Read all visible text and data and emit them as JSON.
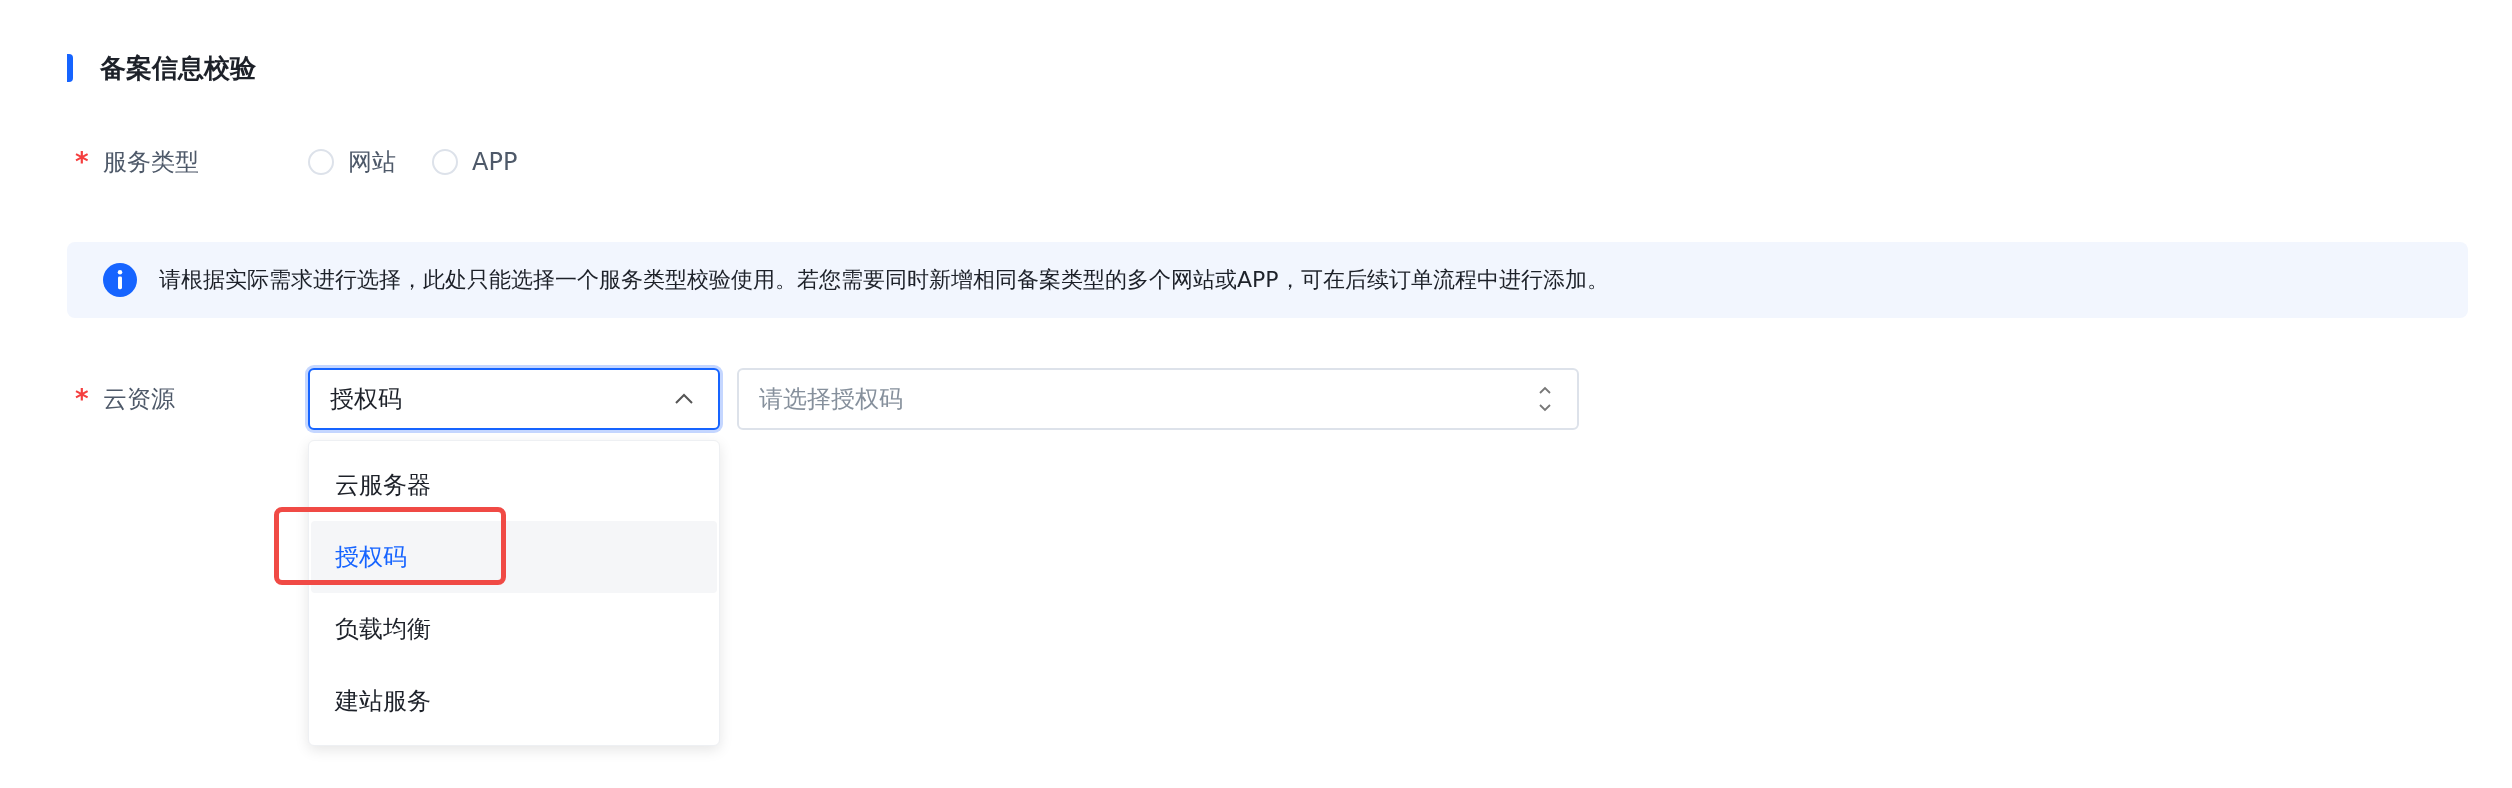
{
  "section": {
    "title": "备案信息校验"
  },
  "service_type": {
    "label": "服务类型",
    "required_mark": "*",
    "options": [
      {
        "label": "网站",
        "selected": false
      },
      {
        "label": "APP",
        "selected": false
      }
    ]
  },
  "notice": {
    "text": "请根据实际需求进行选择，此处只能选择一个服务类型校验使用。若您需要同时新增相同备案类型的多个网站或APP，可在后续订单流程中进行添加。"
  },
  "cloud_resource": {
    "label": "云资源",
    "required_mark": "*",
    "type_select": {
      "value": "授权码",
      "expanded": true,
      "options": [
        {
          "label": "云服务器",
          "selected": false,
          "annotated": false
        },
        {
          "label": "授权码",
          "selected": true,
          "annotated": true
        },
        {
          "label": "负载均衡",
          "selected": false,
          "annotated": false
        },
        {
          "label": "建站服务",
          "selected": false,
          "annotated": false
        }
      ]
    },
    "item_select": {
      "placeholder": "请选择授权码"
    }
  }
}
